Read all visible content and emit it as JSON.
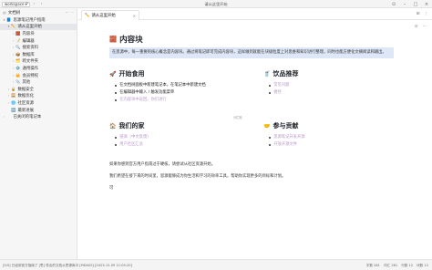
{
  "titlebar": {
    "workspace": "workspace ▾",
    "window_title": "请从这里开始"
  },
  "sidebar": {
    "header_label": "文档树",
    "items": [
      {
        "label": "思源笔记用户指南",
        "icon": "📘",
        "indent": 1,
        "arrow": "▾"
      },
      {
        "label": "请从这里开始",
        "icon": "✏️",
        "indent": 2,
        "arrow": "▾",
        "active": true
      },
      {
        "label": "内容块",
        "icon": "🧱",
        "indent": 3,
        "arrow": "›"
      },
      {
        "label": "编辑器",
        "icon": "📝",
        "indent": 3,
        "arrow": "›"
      },
      {
        "label": "搜索资料",
        "icon": "🔍",
        "indent": 3,
        "arrow": "›"
      },
      {
        "label": "数据库",
        "icon": "📦",
        "indent": 3,
        "arrow": "›"
      },
      {
        "label": "跨文件夹",
        "icon": "🗂️",
        "indent": 3,
        "arrow": "›"
      },
      {
        "label": "通用操作",
        "icon": "⚙️",
        "indent": 3,
        "arrow": "›"
      },
      {
        "label": "会员特权",
        "icon": "👑",
        "indent": 3,
        "arrow": "›"
      },
      {
        "label": "其他",
        "icon": "📎",
        "indent": 3,
        "arrow": "›"
      },
      {
        "label": "数据安全",
        "icon": "🔒",
        "indent": 2,
        "arrow": "›"
      },
      {
        "label": "数据优化",
        "icon": "🧮",
        "indent": 2,
        "arrow": "›"
      },
      {
        "label": "社区资源",
        "icon": "🌐",
        "indent": 2,
        "arrow": "›"
      },
      {
        "label": "最新进展",
        "icon": "🆕",
        "indent": 2,
        "arrow": ""
      },
      {
        "label": "已关闭的笔记本",
        "icon": "",
        "indent": 1,
        "arrow": "›"
      }
    ]
  },
  "tab": {
    "label": "请从这里开始",
    "icon": "✏️"
  },
  "doc": {
    "title": "内容块",
    "title_emoji": "🧱",
    "callout": "在思源中，每一重要的核心概念是内容块。通过将笔记即可完成内容块，这样做到就能在块级粒度上对思维和知识进行整理，同时也能方便化文摘阅读和输出。",
    "section1": {
      "title": "开始食用",
      "emoji": "🚀",
      "bullets": [
        "在文档树面板中新建笔记本，在笔记本中新建文档",
        "在编辑器中输入 / 触发功能菜单",
        "在内容块中返回，你们进行"
      ]
    },
    "section2": {
      "title": "饮品推荐",
      "emoji": "🥤",
      "links": [
        "常见问题",
        "捷径"
      ]
    },
    "section3": {
      "title": "我们的家",
      "emoji": "🏠",
      "links": [
        "链滴（中文反馈）",
        "用户社区汇总"
      ]
    },
    "section4": {
      "title": "参与贡献",
      "emoji": "🤝",
      "links": [
        "思源笔记开发开源",
        "开放开源文件"
      ]
    },
    "para1": "如果你感到官方用户指南过于硬核，请尝试从社区资源开始。",
    "para2": "我们希望在接下来的时间里，思源能够成为你生活和学习的效率工具，帮助你实现更多的目标和计划。",
    "resize_note": "分栏拖",
    "cursor_para": "可"
  },
  "statusbar": {
    "left": "[5/5] 已经到官方指南了 [思] 导出的文档从思源库中 [MDASS] [2023-12-09 11:05:20]",
    "right": [
      "字数 261",
      "词汇 261",
      "行数 12",
      "块数 12"
    ]
  }
}
